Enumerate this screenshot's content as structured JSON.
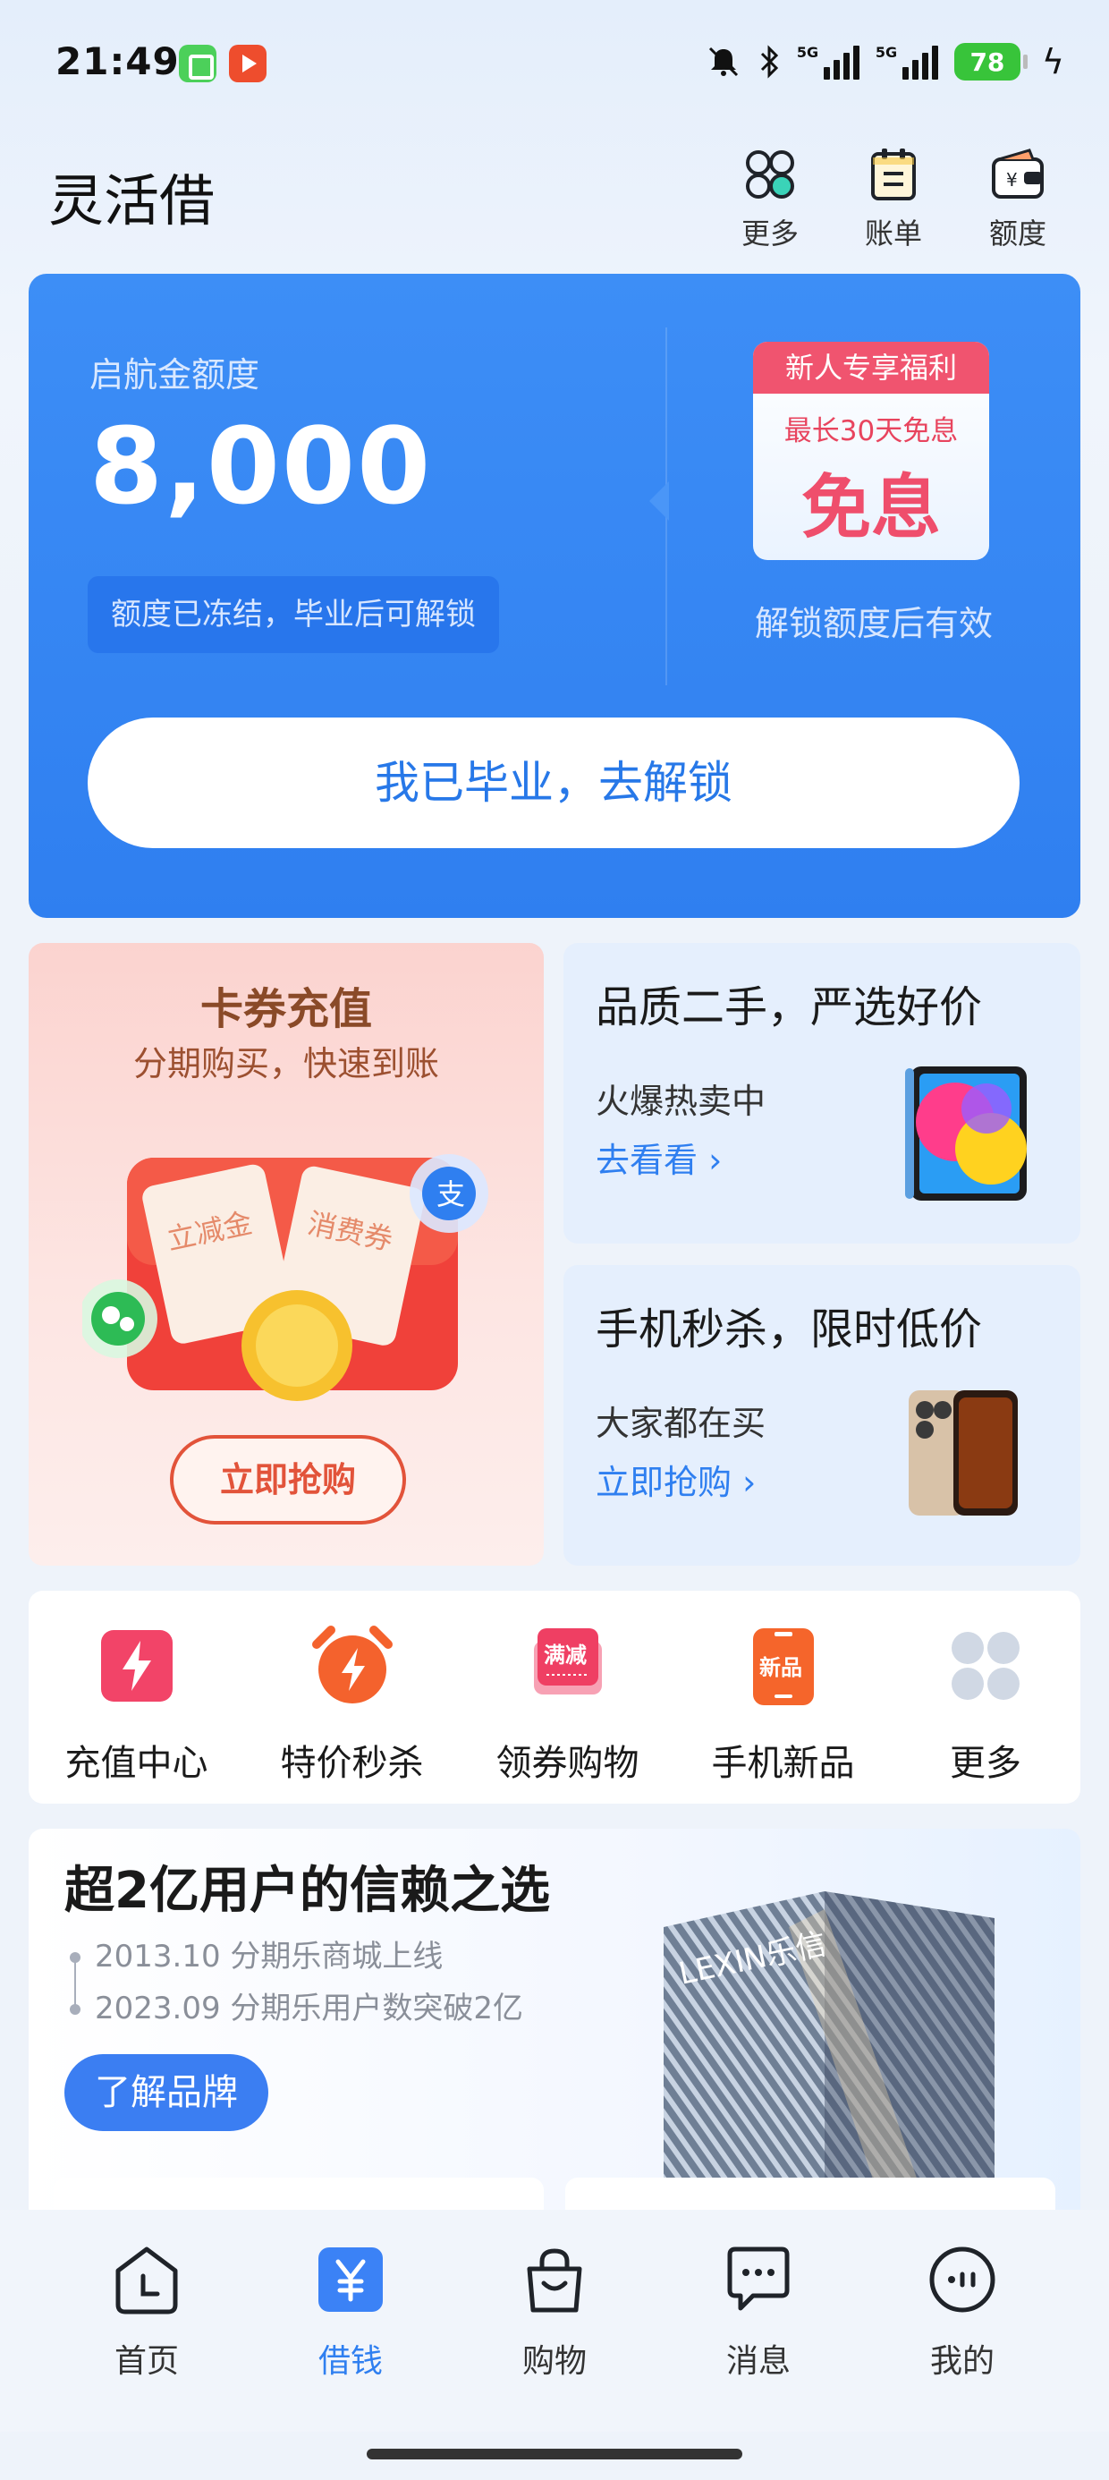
{
  "status_bar": {
    "time": "21:49",
    "network1": "5G",
    "network2": "5G",
    "battery": "78"
  },
  "header": {
    "title": "灵活借",
    "actions": [
      {
        "label": "更多",
        "icon": "more-circles-icon"
      },
      {
        "label": "账单",
        "icon": "bill-icon"
      },
      {
        "label": "额度",
        "icon": "wallet-icon"
      }
    ]
  },
  "credit": {
    "label": "启航金额度",
    "amount": "8,000",
    "frozen_note": "额度已冻结，毕业后可解锁",
    "promo_head": "新人专享福利",
    "promo_sub": "最长30天免息",
    "promo_big": "免息",
    "promo_note": "解锁额度后有效",
    "cta": "我已毕业，去解锁"
  },
  "topup_card": {
    "title": "卡券充值",
    "subtitle": "分期购买，快速到账",
    "button": "立即抢购",
    "coupon1": "立减金",
    "coupon2": "消费券"
  },
  "side_cards": [
    {
      "title": "品质二手，严选好价",
      "subtitle": "火爆热卖中",
      "link": "去看看"
    },
    {
      "title": "手机秒杀，限时低价",
      "subtitle": "大家都在买",
      "link": "立即抢购"
    }
  ],
  "quick_actions": [
    {
      "label": "充值中心",
      "icon": "lightning-icon",
      "color": "#f24468"
    },
    {
      "label": "特价秒杀",
      "icon": "alarm-clock-icon",
      "color": "#f4622d"
    },
    {
      "label": "领券购物",
      "icon": "coupon-icon",
      "color": "#ef3f63",
      "badge": "满减"
    },
    {
      "label": "手机新品",
      "icon": "phone-icon",
      "color": "#f5652b",
      "badge": "新品"
    },
    {
      "label": "更多",
      "icon": "grid-icon",
      "color": "#d0d8e4"
    }
  ],
  "brand": {
    "title": "超2亿用户的信赖之选",
    "timeline": [
      "2013.10 分期乐商城上线",
      "2023.09 分期乐用户数突破2亿"
    ],
    "button": "了解品牌",
    "building_sign": "LEXIN乐信"
  },
  "bottom_nav": [
    {
      "label": "首页",
      "icon": "clock-home-icon",
      "active": false
    },
    {
      "label": "借钱",
      "icon": "yuan-icon",
      "active": true
    },
    {
      "label": "购物",
      "icon": "shopping-bag-icon",
      "active": false
    },
    {
      "label": "消息",
      "icon": "message-icon",
      "active": false
    },
    {
      "label": "我的",
      "icon": "profile-dots-icon",
      "active": false
    }
  ],
  "colors": {
    "accent": "#2f7ff0",
    "promo_red": "#f0546f",
    "card_blue": "#3d8ef6"
  }
}
